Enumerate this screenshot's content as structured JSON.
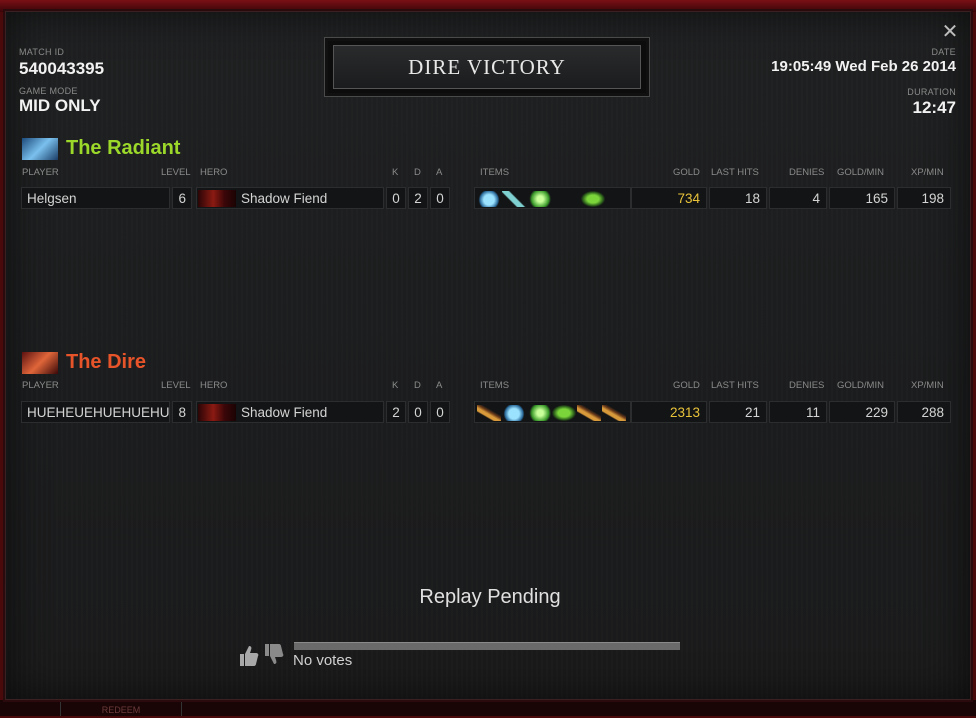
{
  "match": {
    "id_label": "MATCH ID",
    "id": "540043395",
    "mode_label": "GAME MODE",
    "mode": "MID ONLY",
    "result": "DIRE VICTORY",
    "date_label": "DATE",
    "date": "19:05:49 Wed Feb 26 2014",
    "duration_label": "DURATION",
    "duration": "12:47"
  },
  "columns": {
    "player": "PLAYER",
    "level": "LEVEL",
    "hero": "HERO",
    "k": "K",
    "d": "D",
    "a": "A",
    "items": "ITEMS",
    "gold": "GOLD",
    "last_hits": "LAST HITS",
    "denies": "DENIES",
    "gold_min": "GOLD/MIN",
    "xp_min": "XP/MIN"
  },
  "radiant": {
    "name": "The Radiant",
    "color": "#9bd82a",
    "players": [
      {
        "player": "Helgsen",
        "level": "6",
        "hero": "Shadow Fiend",
        "k": "0",
        "d": "2",
        "a": "0",
        "items": [
          "blue-orb-icon",
          "wand-icon",
          "green-boots-icon",
          "leaf-icon"
        ],
        "gold": "734",
        "last_hits": "18",
        "denies": "4",
        "gold_min": "165",
        "xp_min": "198"
      }
    ]
  },
  "dire": {
    "name": "The Dire",
    "color": "#e8542a",
    "players": [
      {
        "player": "HUEHEUEHUEHUEHUEHU",
        "level": "8",
        "hero": "Shadow Fiend",
        "k": "2",
        "d": "0",
        "a": "0",
        "items": [
          "claw-icon",
          "blue-orb-icon",
          "green-boots-icon",
          "leaf-icon",
          "claw-icon",
          "claw-icon"
        ],
        "gold": "2313",
        "last_hits": "21",
        "denies": "11",
        "gold_min": "229",
        "xp_min": "288"
      }
    ]
  },
  "replay": {
    "status": "Replay Pending"
  },
  "votes": {
    "text": "No votes",
    "up_icon": "thumbs-up-icon",
    "down_icon": "thumbs-down-icon"
  },
  "footer": {
    "redeem": "REDEEM"
  }
}
